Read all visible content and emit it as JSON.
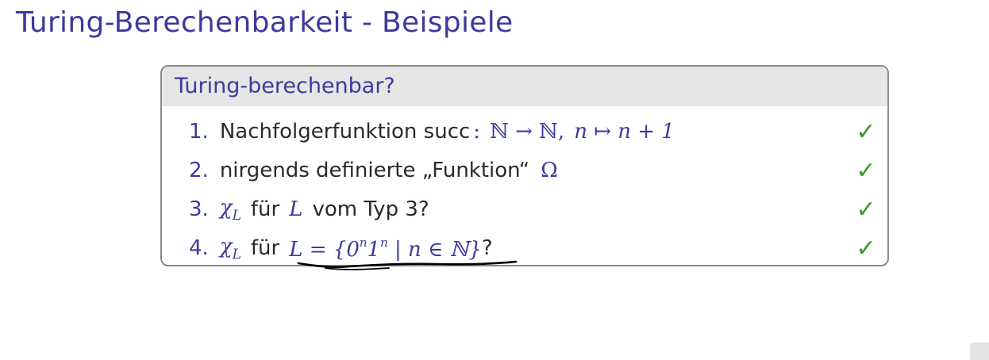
{
  "slide": {
    "title": "Turing-Berechenbarkeit - Beispiele"
  },
  "block": {
    "header": "Turing-berechenbar?",
    "items": [
      {
        "num": "1.",
        "text": "Nachfolgerfunktion succ",
        "colon": ":",
        "math_a": "ℕ → ℕ,",
        "math_b": "n ↦ n + 1",
        "check": "✓"
      },
      {
        "num": "2.",
        "text": "nirgends definierte „Funktion“",
        "math": "Ω",
        "check": "✓"
      },
      {
        "num": "3.",
        "chi": "χ",
        "chi_sub": "L",
        "mid": "für",
        "var": "L",
        "rest": "vom Typ 3?",
        "check": "✓"
      },
      {
        "num": "4.",
        "chi": "χ",
        "chi_sub": "L",
        "mid": "für",
        "set_a": "L = {0",
        "sup1": "n",
        "set_b": "1",
        "sup2": "n",
        "set_c": "| n ∈ ℕ}",
        "q": "?",
        "check": "✓"
      }
    ]
  },
  "colors": {
    "title": "#3b3b9e",
    "check": "#3a9a2a",
    "header_bg": "#e6e6e6",
    "ink": "#000000"
  },
  "icons": {
    "check": "check-icon",
    "corner": "slide-corner-icon"
  }
}
